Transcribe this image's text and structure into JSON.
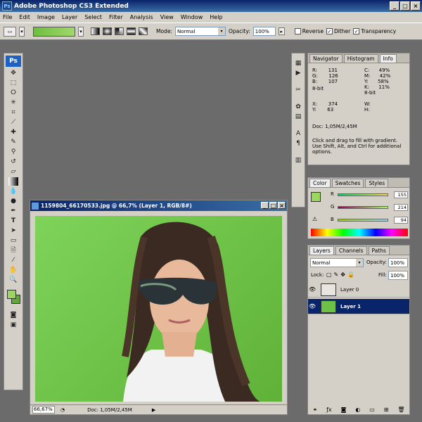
{
  "window": {
    "title": "Adobe Photoshop CS3 Extended"
  },
  "menu": [
    "File",
    "Edit",
    "Image",
    "Layer",
    "Select",
    "Filter",
    "Analysis",
    "View",
    "Window",
    "Help"
  ],
  "options": {
    "mode_label": "Mode:",
    "mode_value": "Normal",
    "opacity_label": "Opacity:",
    "opacity_value": "100%",
    "reverse": "Reverse",
    "dither": "Dither",
    "transparency": "Transparency"
  },
  "document": {
    "title": "1159804_66170533.jpg @ 66,7% (Layer 1, RGB/8#)",
    "zoom": "66,67%",
    "doc_info": "Doc: 1,05M/2,45M"
  },
  "info_panel": {
    "tabs": [
      "Navigator",
      "Histogram",
      "Info"
    ],
    "r": "131",
    "g": "126",
    "b": "107",
    "c": "49%",
    "m": "42%",
    "y_val": "58%",
    "k": "11%",
    "bit1": "8-bit",
    "bit2": "8-bit",
    "x": "374",
    "y": "63",
    "doc": "Doc: 1,05M/2,45M",
    "hint": "Click and drag to fill with gradient.  Use Shift, Alt, and Ctrl for additional options."
  },
  "color_panel": {
    "tabs": [
      "Color",
      "Swatches",
      "Styles"
    ],
    "r": "155",
    "g": "214",
    "b": "94",
    "fg": "#9bd65e"
  },
  "layers_panel": {
    "tabs": [
      "Layers",
      "Channels",
      "Paths"
    ],
    "blend": "Normal",
    "opacity_label": "Opacity:",
    "opacity": "100%",
    "lock_label": "Lock:",
    "fill_label": "Fill:",
    "fill": "100%",
    "layers": [
      "Layer 0",
      "Layer 1"
    ]
  },
  "colors": {
    "accent": "#0a246a",
    "canvas": "#6cc148",
    "selected_layer": "#0a246a"
  }
}
